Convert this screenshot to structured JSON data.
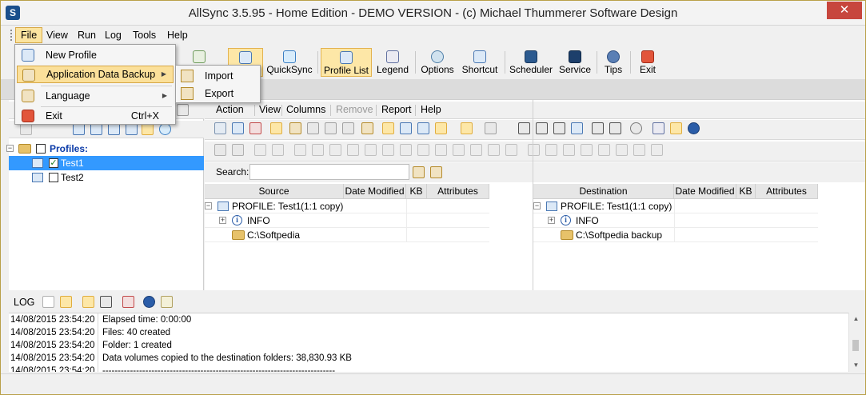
{
  "window": {
    "title": "AllSync 3.5.95 - Home Edition - DEMO VERSION - (c) Michael Thummerer Software Design",
    "close_glyph": "✕"
  },
  "menubar": {
    "items": [
      "File",
      "View",
      "Run",
      "Log",
      "Tools",
      "Help"
    ]
  },
  "file_menu": {
    "new_profile": "New Profile",
    "app_data_backup": "Application Data Backup",
    "language": "Language",
    "exit": "Exit",
    "exit_shortcut": "Ctrl+X"
  },
  "backup_submenu": {
    "import": "Import",
    "export": "Export"
  },
  "toolbar": {
    "quicksync": "QuickSync",
    "profile_list": "Profile List",
    "legend": "Legend",
    "options": "Options",
    "shortcut": "Shortcut",
    "scheduler": "Scheduler",
    "service": "Service",
    "tips": "Tips",
    "exit": "Exit"
  },
  "tree": {
    "root": "Profiles:",
    "profiles": [
      {
        "name": "Test1",
        "checked": true
      },
      {
        "name": "Test2",
        "checked": false
      }
    ]
  },
  "profile_menu": {
    "items": [
      "Action",
      "View",
      "Columns",
      "Remove",
      "Report",
      "Help"
    ]
  },
  "search": {
    "label": "Search:",
    "value": ""
  },
  "source_grid": {
    "headers": [
      "Source",
      "Date Modified",
      "KB",
      "Attributes"
    ],
    "profile": "PROFILE: Test1",
    "copy_note": "(1:1 copy)",
    "info": "INFO",
    "path": "C:\\Softpedia"
  },
  "dest_grid": {
    "headers": [
      "Destination",
      "Date Modified",
      "KB",
      "Attributes"
    ],
    "profile": "PROFILE: Test1",
    "copy_note": "(1:1 copy)",
    "info": "INFO",
    "path": "C:\\Softpedia backup"
  },
  "log": {
    "label": "LOG",
    "rows": [
      {
        "time": "14/08/2015 23:54:20",
        "msg": "Elapsed time: 0:00:00"
      },
      {
        "time": "14/08/2015 23:54:20",
        "msg": "Files: 40 created"
      },
      {
        "time": "14/08/2015 23:54:20",
        "msg": "Folder: 1 created"
      },
      {
        "time": "14/08/2015 23:54:20",
        "msg": "Data volumes copied to the destination folders: 38,830.93 KB"
      },
      {
        "time": "14/08/2015 23:54:20",
        "msg": "----------------------------------------------------------------------------"
      }
    ]
  },
  "colors": {
    "highlight": "#fbe09a",
    "selection": "#3399ff",
    "close": "#c7463d"
  }
}
